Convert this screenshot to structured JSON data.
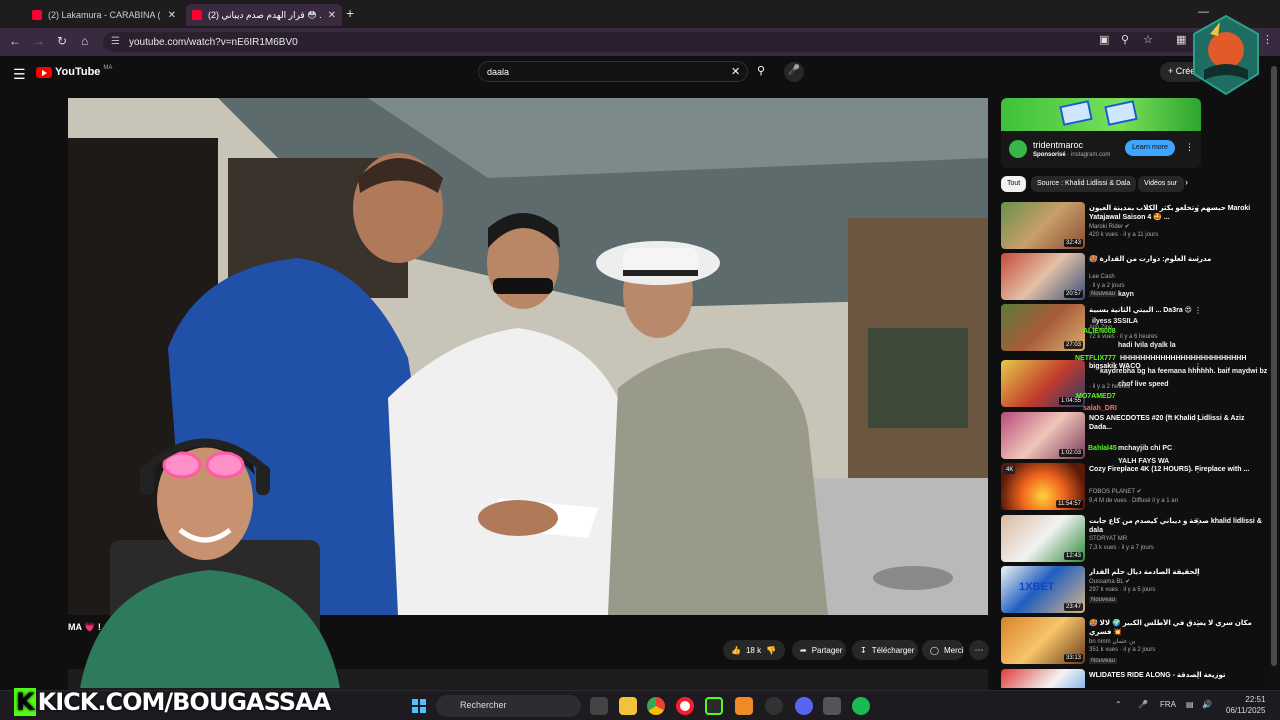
{
  "browser": {
    "tabs": [
      {
        "title": "(2) Lakamura - CARABINA ( Offi",
        "close": "✕"
      },
      {
        "title": "(2) قرار الهدم صدم ديباني 😳 ...",
        "close": "✕"
      }
    ],
    "new_tab": "+",
    "url": "youtube.com/watch?v=nE6IR1M6BV0",
    "window_controls": [
      "—",
      "□",
      "✕"
    ]
  },
  "youtube": {
    "logo_text": "YouTube",
    "logo_region": "MA",
    "search_query": "daala",
    "create_label": "Créer",
    "video_title": "MA 💗 ! قرار الهدم صدم ديباني",
    "actions": {
      "like_count": "18 k",
      "share": "Partager",
      "download": "Télécharger",
      "thanks": "Merci"
    }
  },
  "ad": {
    "name": "tridentmaroc",
    "sponsored": "Sponsorisé",
    "domain": "· instagram.com",
    "cta": "Learn more"
  },
  "chips": [
    "Tout",
    "Source : Khalid Lidlissi & Dala",
    "Vidéos sur"
  ],
  "recommendations": [
    {
      "title": "حبسهم وتخلعو بكثر الكلاب بمدينة العيون Maroki Yatajawal Saison 4 🤩 ...",
      "channel": "Maroki Rider ✔",
      "meta": "420 k vues · il y a 11 jours",
      "duration": "32:43",
      "badge": ""
    },
    {
      "title": "🥵 مدرسة العلوم: دوارت من القدارة",
      "channel": "Lee Cash",
      "meta": "· il y a 2 jours",
      "duration": "20:57",
      "badge": "Nouveau"
    },
    {
      "title": "البيتي الثانية بسبية ... Da3ra 😍",
      "channel": "Allo Zino",
      "meta": "72 k vues · il y a 6 heures",
      "duration": "27:03",
      "badge": ""
    },
    {
      "title": "bigsakik WACO",
      "channel": "",
      "meta": "· il y a 2 heures",
      "duration": "1:04:55",
      "badge": ""
    },
    {
      "title": "NOS ANECDOTES #20 (ft Khalid Lidlissi & Aziz Dada...",
      "channel": "",
      "meta": "",
      "duration": "1:02:03",
      "badge": ""
    },
    {
      "title": "Cozy Fireplace 4K (12 HOURS). Fireplace with ...",
      "channel": "FOBOS PLANET ✔",
      "meta": "9,4 M de vues · Diffusé il y a 1 an",
      "duration": "11:54:57",
      "badge": ""
    },
    {
      "title": "صدقة و ديباني كيصدم من كاع جابت khalid lidlissi & dala",
      "channel": "STORYAT MR",
      "meta": "7,3 k vues · il y a 7 jours",
      "duration": "12:43",
      "badge": ""
    },
    {
      "title": "الحقيقة الصادمة ديال حلم الفدار",
      "channel": "Oussama BL ✔",
      "meta": "297 k vues · il y a 5 jours",
      "duration": "23:47",
      "badge": "Nouveau"
    },
    {
      "title": "🥵 مكان سري لا يصدق في الأطلس الكبير 🌍 لالا فسري 💥",
      "channel": "bn nmm بن عثمان",
      "meta": "351 k vues · il y a 2 jours",
      "duration": "33:13",
      "badge": "Nouveau"
    },
    {
      "title": "WLIDATES RIDE ALONG - توزيعة الصدقة",
      "channel": "",
      "meta": "",
      "duration": "",
      "badge": ""
    }
  ],
  "chat_overlay": [
    {
      "text": "kayn",
      "color": "#ffffff"
    },
    {
      "text": "ilyess 3SSILA",
      "color": "#ffffff"
    },
    {
      "text": "ALIEN008",
      "color": "#53fc18"
    },
    {
      "text": "hadi lvila dyalk la",
      "color": "#ffffff"
    },
    {
      "text": "NETFLIX777",
      "color": "#53fc18"
    },
    {
      "text": "HHHHHHHHHHHHHHHHHHHHHHHHH",
      "color": "#ffffff"
    },
    {
      "text": "kaydrebha bg ha feemana hhhhhh. baif maydwi bz",
      "color": "#ffffff"
    },
    {
      "text": "chof live speed",
      "color": "#ffffff"
    },
    {
      "text": "MO7AMED7",
      "color": "#53fc18"
    },
    {
      "text": "YALH FAYS WA",
      "color": "#ffffff"
    },
    {
      "text": "mchayjib chi PC",
      "color": "#ffffff"
    },
    {
      "text": "salah_DRI",
      "color": "#ff6b6b"
    },
    {
      "text": "Bahlal45",
      "color": "#53fc18"
    }
  ],
  "stream": {
    "kick_url": "KICK.COM/BOUGASSAA"
  },
  "taskbar": {
    "search_placeholder": "Rechercher",
    "language": "FRA",
    "time": "22:51",
    "date": "06/11/2025"
  },
  "colors": {
    "youtube_red": "#ff0000",
    "kick_green": "#53fc18",
    "browser_accent": "#3a2a3f",
    "learn_more_blue": "#3ea6ff"
  }
}
